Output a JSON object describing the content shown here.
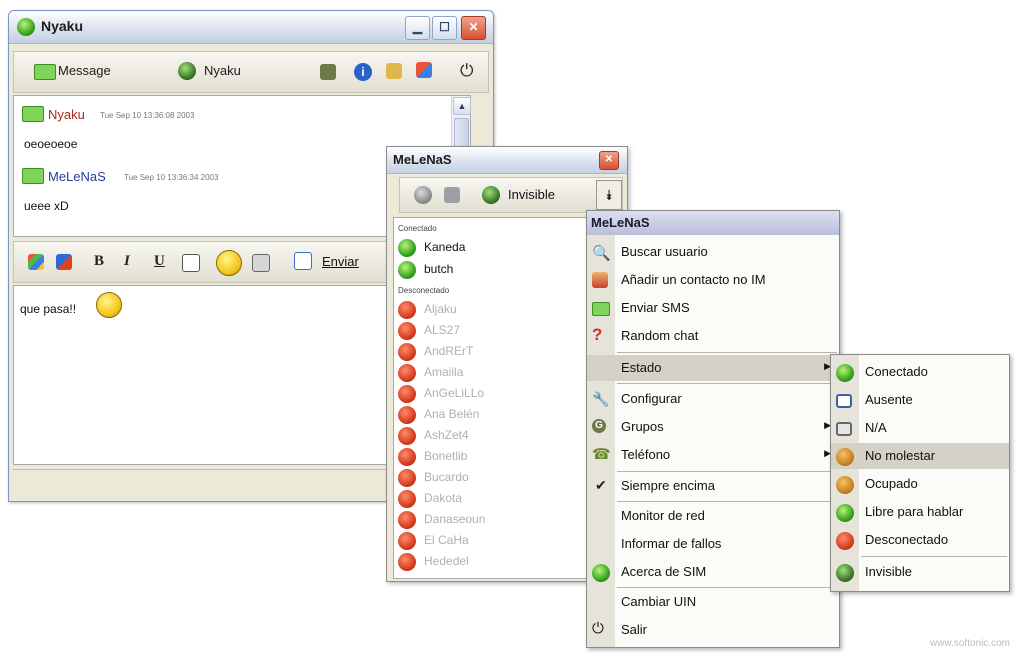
{
  "chat_window": {
    "title": "Nyaku",
    "toolbar": {
      "message_label": "Message",
      "contact_label": "Nyaku"
    },
    "history": [
      {
        "name": "Nyaku",
        "time": "Tue Sep 10 13:36:08 2003",
        "text": "oeoeoeoe",
        "name_color": "#b02a1a"
      },
      {
        "name": "MeLeNaS",
        "time": "Tue Sep 10 13:36:34 2003",
        "text": "ueee xD",
        "name_color": "#1f3f99"
      }
    ],
    "format": {
      "bold": "B",
      "italic": "I",
      "underline": "U",
      "send_label": "Enviar"
    },
    "input_text": "que pasa!!"
  },
  "contact_list": {
    "title": "MeLeNaS",
    "status_label": "Invisible",
    "online_group": "Conectado",
    "offline_group": "Desconectado",
    "online": [
      "Kaneda",
      "butch"
    ],
    "offline": [
      "Aljaku",
      "ALS27",
      "AndRErT",
      "Amaiila",
      "AnGeLiLLo",
      "Ana Belén",
      "AshZet4",
      "Bonetlib",
      "Bucardo",
      "Dakota",
      "Danaseoun",
      "El CaHa",
      "Hededel"
    ]
  },
  "main_menu": {
    "header": "MeLeNaS",
    "items": [
      {
        "label": "Buscar usuario",
        "icon": "magnifier-user-icon"
      },
      {
        "label": "Añadir un contacto no IM",
        "icon": "add-contact-icon"
      },
      {
        "label": "Enviar SMS",
        "icon": "sms-icon"
      },
      {
        "label": "Random chat",
        "icon": "random-chat-icon"
      },
      {
        "label": "Estado",
        "icon": "",
        "submenu": true
      },
      {
        "label": "Configurar",
        "icon": "wrench-icon"
      },
      {
        "label": "Grupos",
        "icon": "groups-icon",
        "submenu": true
      },
      {
        "label": "Teléfono",
        "icon": "phone-icon",
        "submenu": true
      },
      {
        "label": "Siempre encima",
        "icon": "check-icon"
      },
      {
        "label": "Monitor de red",
        "icon": ""
      },
      {
        "label": "Informar de fallos",
        "icon": ""
      },
      {
        "label": "Acerca de SIM",
        "icon": "sim-flower-icon"
      },
      {
        "label": "Cambiar UIN",
        "icon": ""
      },
      {
        "label": "Salir",
        "icon": "power-icon"
      }
    ]
  },
  "status_menu": {
    "items": [
      "Conectado",
      "Ausente",
      "N/A",
      "No molestar",
      "Ocupado",
      "Libre para hablar",
      "Desconectado",
      "Invisible"
    ]
  },
  "watermark": "www.softonic.com"
}
